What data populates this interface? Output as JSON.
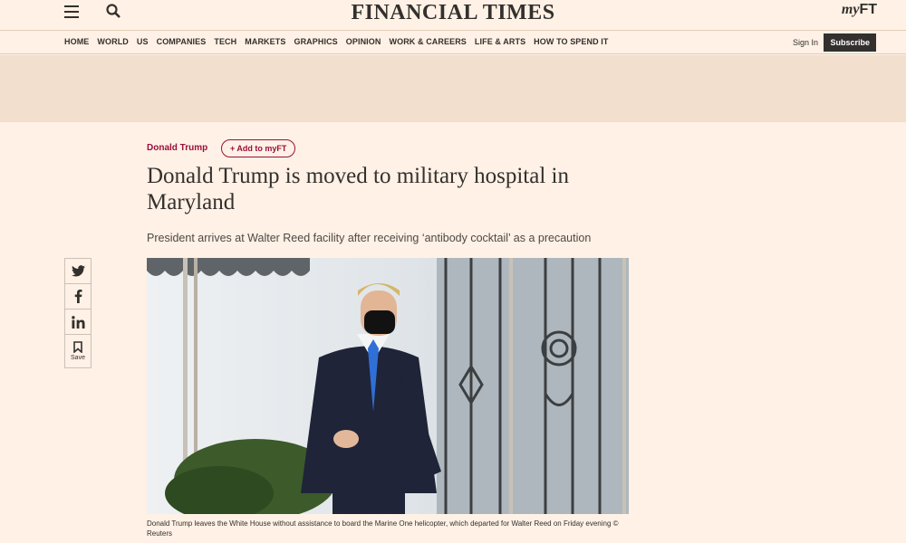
{
  "header": {
    "logo": "FINANCIAL TIMES",
    "myft_prefix": "my",
    "myft_suffix": "FT"
  },
  "nav": {
    "items": [
      "HOME",
      "WORLD",
      "US",
      "COMPANIES",
      "TECH",
      "MARKETS",
      "GRAPHICS",
      "OPINION",
      "WORK & CAREERS",
      "LIFE & ARTS",
      "HOW TO SPEND IT"
    ],
    "sign_in": "Sign In",
    "subscribe": "Subscribe"
  },
  "article": {
    "topic": "Donald Trump",
    "add_to_myft": "+ Add to myFT",
    "headline": "Donald Trump is moved to military hospital in Maryland",
    "standfirst": "President arrives at Walter Reed facility after receiving ‘antibody cocktail’ as a precaution",
    "caption": "Donald Trump leaves the White House without assistance to board the Marine One helicopter, which departed for Walter Reed on Friday evening © Reuters"
  },
  "share": {
    "save_label": "Save"
  },
  "colors": {
    "background": "#fff1e5",
    "accent": "#990f3d",
    "ad_band": "#f2dfce"
  }
}
